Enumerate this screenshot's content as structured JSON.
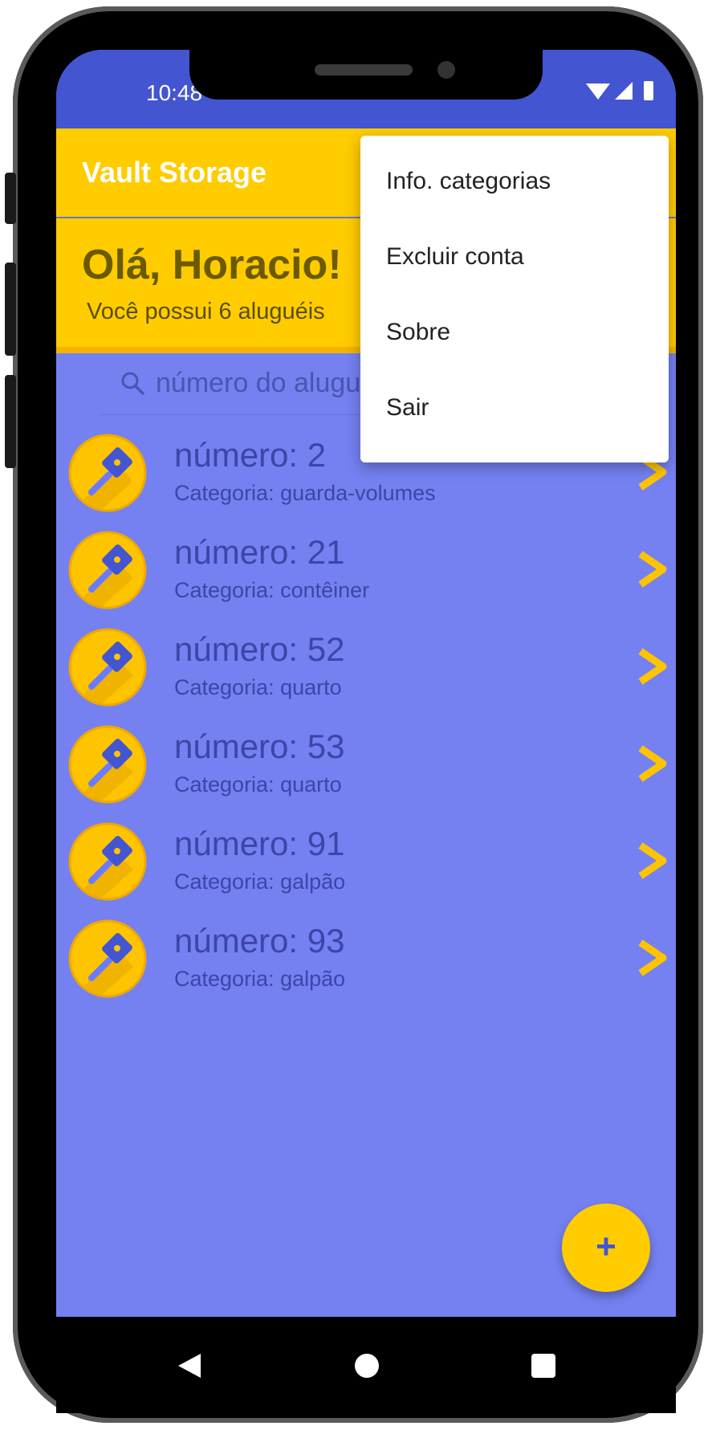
{
  "status_bar": {
    "time": "10:48"
  },
  "app_bar": {
    "title": "Vault Storage"
  },
  "header": {
    "greeting": "Olá, Horacio!",
    "subtitle": "Você possui 6 aluguéis"
  },
  "search": {
    "placeholder": "número do aluguel"
  },
  "rentals": [
    {
      "number": "número: 2",
      "category": "Categoria: guarda-volumes"
    },
    {
      "number": "número: 21",
      "category": "Categoria: contêiner"
    },
    {
      "number": "número: 52",
      "category": "Categoria: quarto"
    },
    {
      "number": "número: 53",
      "category": "Categoria: quarto"
    },
    {
      "number": "número: 91",
      "category": "Categoria: galpão"
    },
    {
      "number": "número: 93",
      "category": "Categoria: galpão"
    }
  ],
  "fab": {
    "label": "+"
  },
  "overflow_menu": {
    "items": [
      {
        "label": "Info. categorias"
      },
      {
        "label": "Excluir conta"
      },
      {
        "label": "Sobre"
      },
      {
        "label": "Sair"
      }
    ]
  },
  "colors": {
    "primary": "#4355d1",
    "accent": "#ffcc00",
    "background": "#7581f1"
  },
  "icons": {
    "list_item": "key-icon",
    "chevron": "chevron-right-icon"
  }
}
